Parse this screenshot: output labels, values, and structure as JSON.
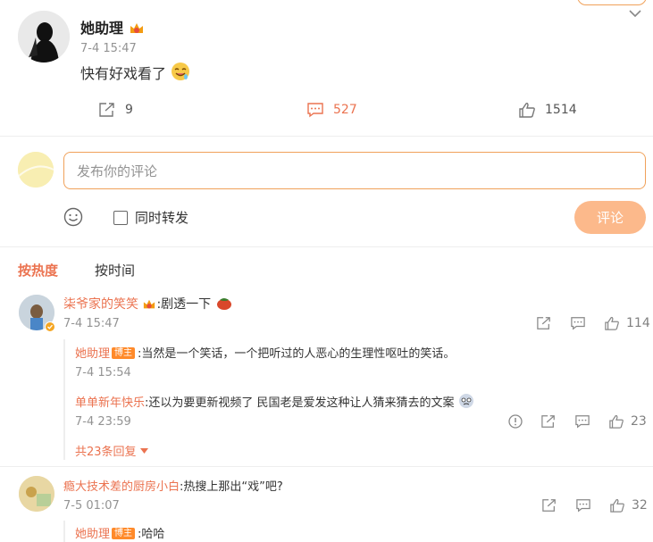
{
  "post": {
    "author": "她助理",
    "time": "7-4 15:47",
    "text": "快有好戏看了",
    "repost_count": "9",
    "comment_count": "527",
    "like_count": "1514"
  },
  "composer": {
    "placeholder": "发布你的评论",
    "repost_label": "同时转发",
    "submit_label": "评论"
  },
  "tabs": {
    "hot": "按热度",
    "time": "按时间"
  },
  "comments": [
    {
      "author": "柒爷家的笑笑",
      "text": ":剧透一下",
      "time": "7-4 15:47",
      "like_count": "114",
      "replies": [
        {
          "author": "她助理",
          "badge": "博主",
          "text": ":当然是一个笑话，一个把听过的人恶心的生理性呕吐的笑话。",
          "time": "7-4 15:54"
        },
        {
          "author": "单单新年快乐",
          "text": ":还以为要更新视频了 民国老是爱发这种让人猜来猜去的文案",
          "time": "7-4 23:59",
          "like_count": "23"
        }
      ],
      "more_replies": "共23条回复"
    },
    {
      "author": "瘾大技术差的厨房小白",
      "text": ":热搜上那出“戏”吧?",
      "time": "7-5 01:07",
      "like_count": "32",
      "replies": [
        {
          "author": "她助理",
          "badge": "博主",
          "text": ":哈哈"
        }
      ]
    }
  ],
  "colors": {
    "accent": "#eb7350",
    "input_border": "#f0a15a",
    "button_bg": "#fcb98b"
  }
}
